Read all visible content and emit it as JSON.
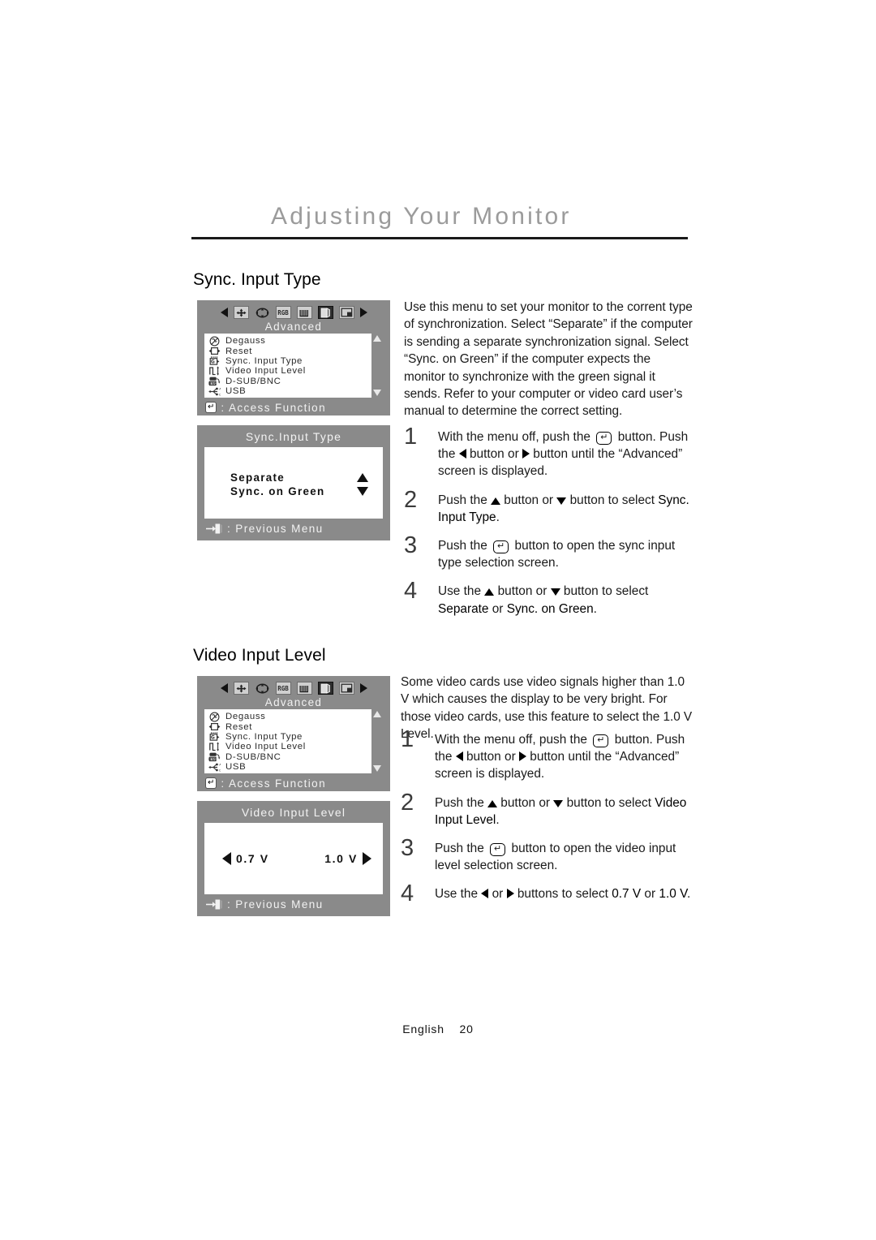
{
  "header": {
    "chapter_title": "Adjusting Your Monitor"
  },
  "sections": [
    {
      "heading": "Sync. Input Type",
      "paragraph": "Use this menu to set your monitor to the corrent type of synchronization. Select “Separate” if the computer is sending a separate synchronization signal. Select “Sync. on Green” if the computer expects the monitor to synchronize with the green signal it sends. Refer to your computer or video card user’s manual to determine the correct setting.",
      "steps": [
        {
          "number": "1",
          "parts": [
            {
              "t": "text",
              "v": "With the menu off, push the "
            },
            {
              "t": "enter"
            },
            {
              "t": "text",
              "v": " button. Push the "
            },
            {
              "t": "tri-left"
            },
            {
              "t": "text",
              "v": " button or "
            },
            {
              "t": "tri-right"
            },
            {
              "t": "text",
              "v": " button until the “Advanced” screen is displayed."
            }
          ]
        },
        {
          "number": "2",
          "parts": [
            {
              "t": "text",
              "v": "Push the "
            },
            {
              "t": "tri-up"
            },
            {
              "t": "text",
              "v": " button or "
            },
            {
              "t": "tri-down"
            },
            {
              "t": "text",
              "v": " button to select "
            },
            {
              "t": "bold",
              "v": "Sync. Input Type"
            },
            {
              "t": "text",
              "v": "."
            }
          ]
        },
        {
          "number": "3",
          "parts": [
            {
              "t": "text",
              "v": "Push the "
            },
            {
              "t": "enter"
            },
            {
              "t": "text",
              "v": " button to open the sync input type selection screen."
            }
          ]
        },
        {
          "number": "4",
          "parts": [
            {
              "t": "text",
              "v": "Use the "
            },
            {
              "t": "tri-up"
            },
            {
              "t": "text",
              "v": " button or "
            },
            {
              "t": "tri-down"
            },
            {
              "t": "text",
              "v": " button to select "
            },
            {
              "t": "bold",
              "v": "Separate"
            },
            {
              "t": "text",
              "v": " or "
            },
            {
              "t": "bold",
              "v": "Sync. on Green"
            },
            {
              "t": "text",
              "v": "."
            }
          ]
        }
      ]
    },
    {
      "heading": "Video Input Level",
      "paragraph": "Some video cards use video signals higher than 1.0 V which causes the display to be very bright. For those video cards, use this feature to select the 1.0 V Level.",
      "steps": [
        {
          "number": "1",
          "parts": [
            {
              "t": "text",
              "v": "With the menu off, push the "
            },
            {
              "t": "enter"
            },
            {
              "t": "text",
              "v": " button. Push the "
            },
            {
              "t": "tri-left"
            },
            {
              "t": "text",
              "v": " button or "
            },
            {
              "t": "tri-right"
            },
            {
              "t": "text",
              "v": " button until the “Advanced” screen is displayed."
            }
          ]
        },
        {
          "number": "2",
          "parts": [
            {
              "t": "text",
              "v": "Push the "
            },
            {
              "t": "tri-up"
            },
            {
              "t": "text",
              "v": " button or "
            },
            {
              "t": "tri-down"
            },
            {
              "t": "text",
              "v": " button to select "
            },
            {
              "t": "bold",
              "v": "Video Input Level"
            },
            {
              "t": "text",
              "v": "."
            }
          ]
        },
        {
          "number": "3",
          "parts": [
            {
              "t": "text",
              "v": "Push the "
            },
            {
              "t": "enter"
            },
            {
              "t": "text",
              "v": " button to open the video input level selection screen."
            }
          ]
        },
        {
          "number": "4",
          "parts": [
            {
              "t": "text",
              "v": "Use the "
            },
            {
              "t": "tri-left"
            },
            {
              "t": "text",
              "v": " or "
            },
            {
              "t": "tri-right"
            },
            {
              "t": "text",
              "v": " buttons to select "
            },
            {
              "t": "bold",
              "v": "0.7 V"
            },
            {
              "t": "text",
              "v": " or "
            },
            {
              "t": "bold",
              "v": "1.0 V"
            },
            {
              "t": "text",
              "v": "."
            }
          ]
        }
      ]
    }
  ],
  "osd": {
    "advanced_menu": {
      "tab_icons": [
        {
          "name": "position-icon",
          "selected": false
        },
        {
          "name": "geometry-icon",
          "selected": false
        },
        {
          "name": "rgb-color-icon",
          "selected": false
        },
        {
          "name": "moire-icon",
          "selected": false
        },
        {
          "name": "advanced-icon",
          "selected": true
        },
        {
          "name": "osd-menu-icon",
          "selected": false
        }
      ],
      "subtitle": "Advanced",
      "items": [
        {
          "icon": "degauss-icon",
          "label": "Degauss"
        },
        {
          "icon": "reset-icon",
          "label": "Reset"
        },
        {
          "icon": "sync-input-type-icon",
          "label": "Sync. Input Type"
        },
        {
          "icon": "video-input-level-icon",
          "label": "Video Input Level"
        },
        {
          "icon": "dsub-bnc-icon",
          "label": "D-SUB/BNC"
        },
        {
          "icon": "usb-icon",
          "label": "USB"
        }
      ],
      "footer_key": "↵",
      "footer_label": ": Access Function",
      "scroll_up": "scroll-up-arrow",
      "scroll_down": "scroll-down-arrow"
    },
    "sync_input_type_screen": {
      "title": "Sync.Input Type",
      "options": [
        {
          "label": "Separate",
          "arrow": "up"
        },
        {
          "label": "Sync. on Green",
          "arrow": "down"
        }
      ],
      "footer_label": ": Previous Menu",
      "footer_icon": "exit-icon"
    },
    "video_input_level_screen": {
      "title": "Video Input Level",
      "left_value": "0.7 V",
      "right_value": "1.0 V",
      "footer_label": ": Previous Menu",
      "footer_icon": "exit-icon"
    }
  },
  "footer": {
    "language": "English",
    "page_number": "20"
  }
}
